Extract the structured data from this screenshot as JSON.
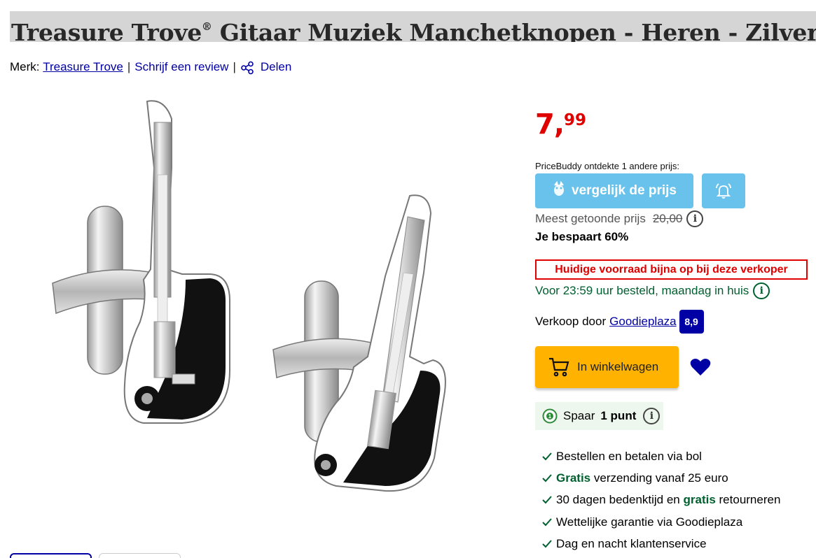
{
  "product": {
    "title": "Treasure Trove",
    "title_reg": "®",
    "title_rest": " Gitaar Muziek Manchetknopen - Heren - Zilverkleurig"
  },
  "meta": {
    "brand_label": "Merk:",
    "brand_name": "Treasure Trove",
    "sep1": "|",
    "review_link": "Schrijf een review",
    "sep2": "|",
    "share_link": "Delen"
  },
  "price": {
    "euros": "7,",
    "cents": "99",
    "color": "#e10000"
  },
  "pricebuddy": {
    "note": "PriceBuddy ontdekte 1 andere prijs:",
    "compare_label": "vergelijk de prijs",
    "color": "#68c2ec"
  },
  "list_price": {
    "label": "Meest getoonde prijs",
    "value": "20,00",
    "info": "i"
  },
  "savings": "Je bespaart 60%",
  "stock_warning": "Huidige voorraad bijna op bij deze verkoper",
  "delivery": {
    "text": "Voor 23:59 uur besteld, maandag in huis",
    "info": "i"
  },
  "seller": {
    "label": "Verkoop door",
    "name": "Goodieplaza",
    "score": "8,9"
  },
  "cart": {
    "label": "In winkelwagen",
    "color": "#ffb200"
  },
  "points": {
    "prefix": "Spaar",
    "amount": "1 punt",
    "info": "i"
  },
  "usps": [
    {
      "pre": "Bestellen en betalen via bol",
      "bold": "",
      "post": ""
    },
    {
      "pre": "",
      "bold": "Gratis",
      "post": " verzending vanaf 25 euro"
    },
    {
      "pre": "30 dagen bedenktijd en ",
      "bold": "gratis",
      "post": " retourneren"
    },
    {
      "pre": "Wettelijke garantie via Goodieplaza",
      "bold": "",
      "post": ""
    },
    {
      "pre": "Dag en nacht klantenservice",
      "bold": "",
      "post": ""
    }
  ]
}
